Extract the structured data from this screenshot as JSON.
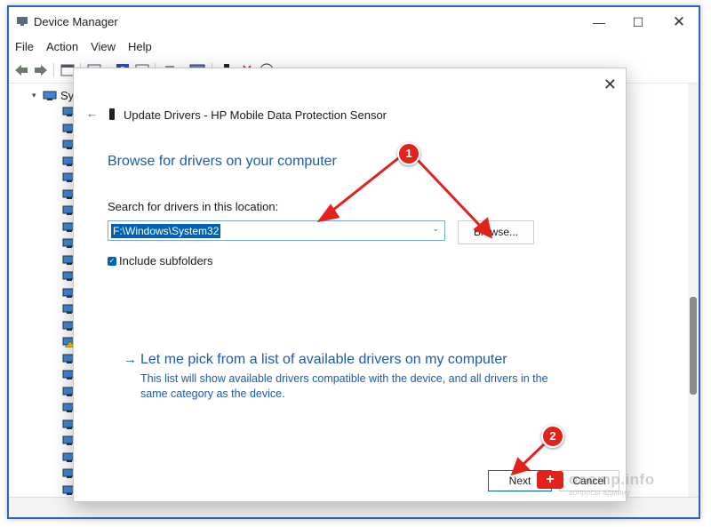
{
  "window": {
    "title": "Device Manager",
    "minimize_glyph": "—",
    "maximize_glyph": "☐",
    "close_glyph": "✕"
  },
  "menu": [
    "File",
    "Action",
    "View",
    "Help"
  ],
  "tree": {
    "root_label": "Syst",
    "expand_glyph": "▾"
  },
  "dialog": {
    "title": "Update Drivers - HP Mobile Data Protection Sensor",
    "back_glyph": "←",
    "close_glyph": "✕",
    "heading": "Browse for drivers on your computer",
    "search_label": "Search for drivers in this location:",
    "path_value": "F:\\Windows\\System32",
    "browse_label": "Browse...",
    "include_subfolders_label": "Include subfolders",
    "include_subfolders_checked": true,
    "pick_arrow": "→",
    "pick_link": "Let me pick from a list of available drivers on my computer",
    "pick_description": "This list will show available drivers compatible with the device, and all drivers in the same category as the device.",
    "next_label": "Next",
    "cancel_label": "Cancel"
  },
  "annotations": {
    "badge1": "1",
    "badge2": "2",
    "color": "#e2231a"
  },
  "watermark": {
    "text": "ocomp.info",
    "sub": "вопросы админу",
    "badge_glyph": "+"
  },
  "colors": {
    "accent": "#0063b1",
    "link": "#1e5aa8",
    "window_border": "#2f64b8"
  }
}
